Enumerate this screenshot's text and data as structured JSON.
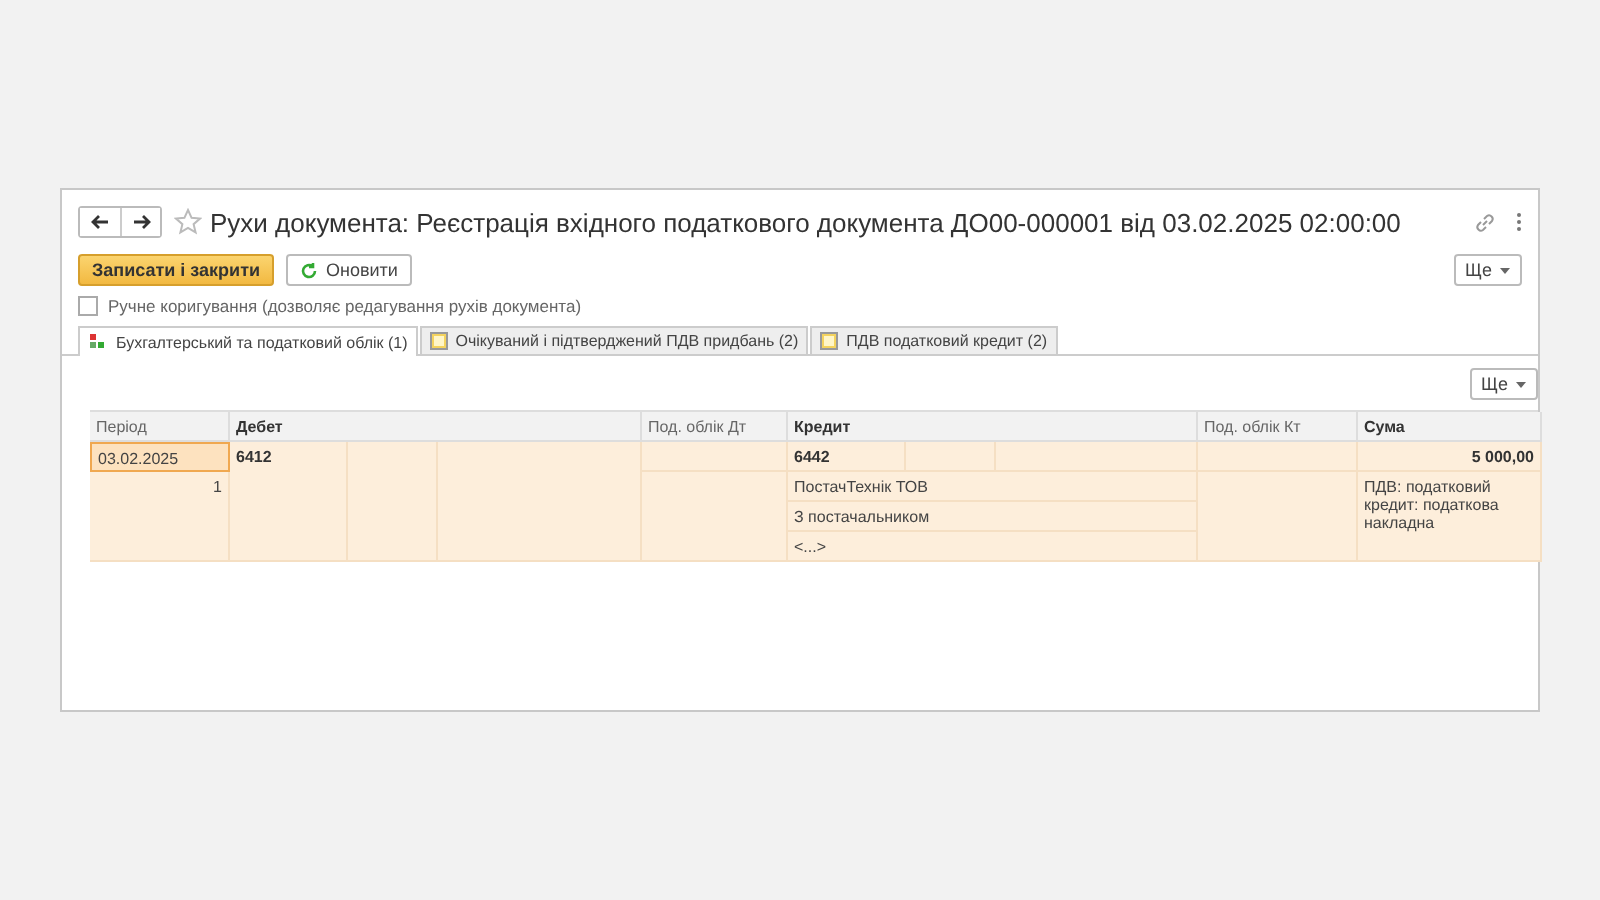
{
  "window": {
    "title": "Рухи документа: Реєстрація вхідного податкового документа ДО00-000001 від 03.02.2025 02:00:00"
  },
  "toolbar": {
    "save_button": "Записати і закрити",
    "refresh_button": "Оновити",
    "more_button": "Ще"
  },
  "manual_edit": {
    "label": "Ручне коригування (дозволяє редагування рухів документа)",
    "checked": false
  },
  "tabs": [
    {
      "label": "Бухгалтерський та податковий облік (1)",
      "kind": "accounting",
      "selected": true
    },
    {
      "label": "Очікуваний і підтверджений ПДВ придбань (2)",
      "kind": "register",
      "selected": false
    },
    {
      "label": "ПДВ податковий кредит (2)",
      "kind": "register",
      "selected": false
    }
  ],
  "table_more_button": "Ще",
  "table": {
    "columns": [
      "Період",
      "Дебет",
      "Под. облік Дт",
      "Кредит",
      "Под. облік Кт",
      "Сума"
    ],
    "rows": [
      {
        "period": "03.02.2025",
        "number": "1",
        "selected": true,
        "debit": "6412",
        "credit": "6442",
        "credit_details": [
          "ПостачТехнік ТОВ",
          "З постачальником",
          "<...>"
        ],
        "amount": "5 000,00",
        "amount_note": "ПДВ: податковий кредит: податкова накладна"
      }
    ]
  }
}
